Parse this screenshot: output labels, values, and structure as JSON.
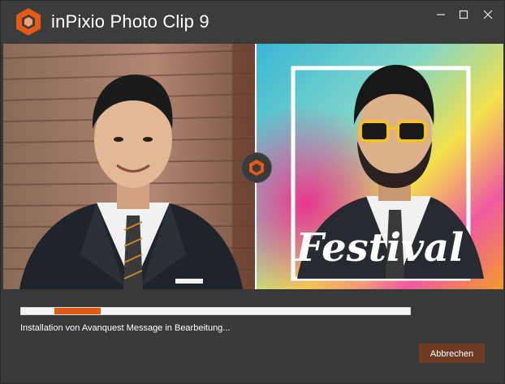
{
  "window": {
    "title": "inPixio Photo Clip 9",
    "controls": {
      "minimize_icon": "minimize-icon",
      "maximize_icon": "maximize-icon",
      "close_icon": "close-icon"
    }
  },
  "hero": {
    "festival_text": "Festival"
  },
  "install": {
    "progress_fraction": 0.12,
    "progress_offset_fraction": 0.085,
    "status_text": "Installation von Avanquest Message in Bearbeitung..."
  },
  "actions": {
    "cancel_label": "Abbrechen"
  },
  "colors": {
    "accent": "#e35a14",
    "cancel_button": "#6e3b22",
    "background": "#393939"
  }
}
